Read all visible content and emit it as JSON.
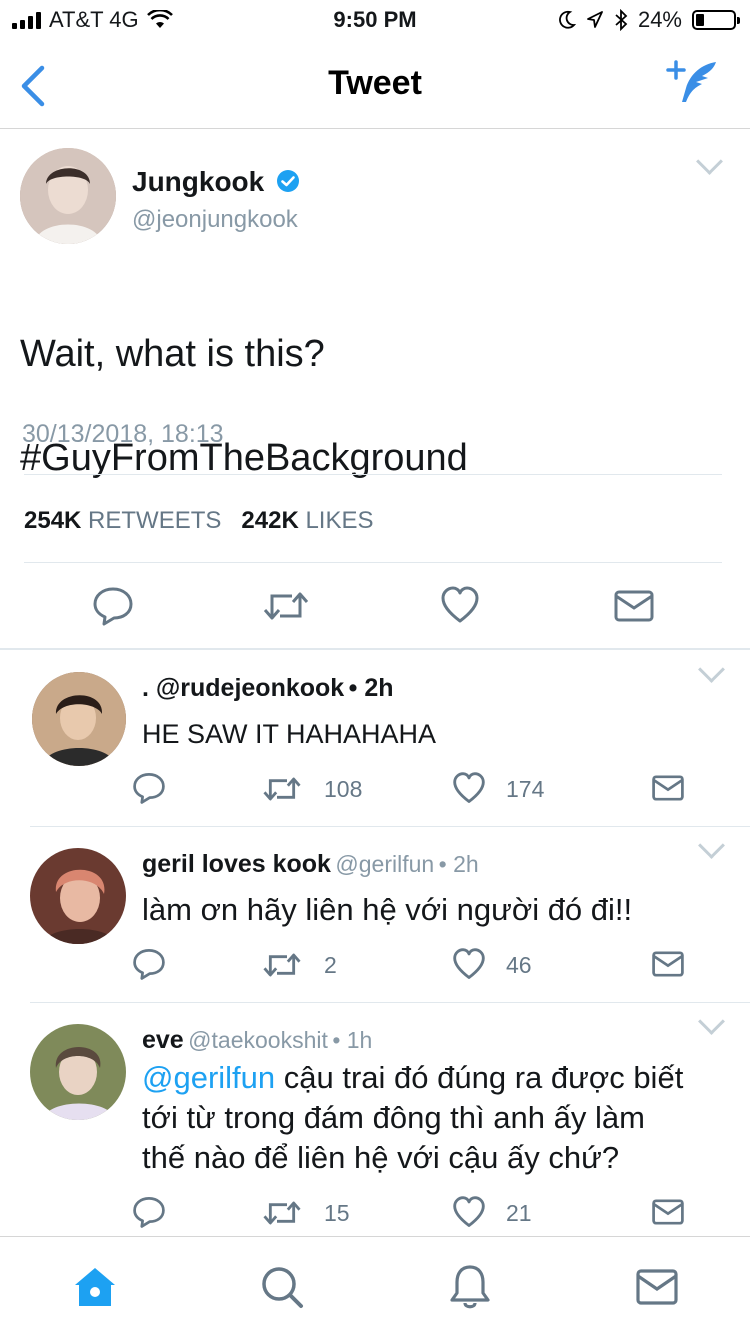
{
  "status_bar": {
    "carrier": "AT&T 4G",
    "time": "9:50 PM",
    "battery": "24%"
  },
  "nav": {
    "title": "Tweet",
    "back_icon": "chevron-left-icon",
    "compose_icon": "compose-tweet-icon"
  },
  "tweet": {
    "author_name": "Jungkook",
    "verified": true,
    "handle": "@jeonjungkook",
    "text_line1": "Wait, what is this?",
    "text_line2": "#GuyFromTheBackground",
    "timestamp": "30/13/2018, 18:13",
    "retweets_count": "254K",
    "retweets_label": "RETWEETS",
    "likes_count": "242K",
    "likes_label": "LIKES"
  },
  "replies": [
    {
      "name": ". @rudejeonkook",
      "handle": "",
      "age": "• 2h",
      "text": "HE SAW IT HAHAHAHA",
      "retweets": "108",
      "likes": "174"
    },
    {
      "name": "geril loves kook",
      "handle": "@gerilfun",
      "age": "• 2h",
      "text": "làm ơn hãy liên hệ với người đó đi!!",
      "retweets": "2",
      "likes": "46"
    },
    {
      "name": "eve",
      "handle": "@taekookshit",
      "age": "• 1h",
      "mention": "@gerilfun",
      "text_line1": " cậu trai đó đúng ra được biết",
      "text_line2": "tới từ trong đám đông thì anh ấy làm",
      "text_line3": "thế nào để liên hệ với cậu ấy chứ?",
      "retweets": "15",
      "likes": "21"
    }
  ],
  "colors": {
    "accent": "#1da1f2",
    "nav_blue": "#3a8ee6",
    "secondary_text": "#8899a6",
    "icon_gray": "#657786"
  }
}
